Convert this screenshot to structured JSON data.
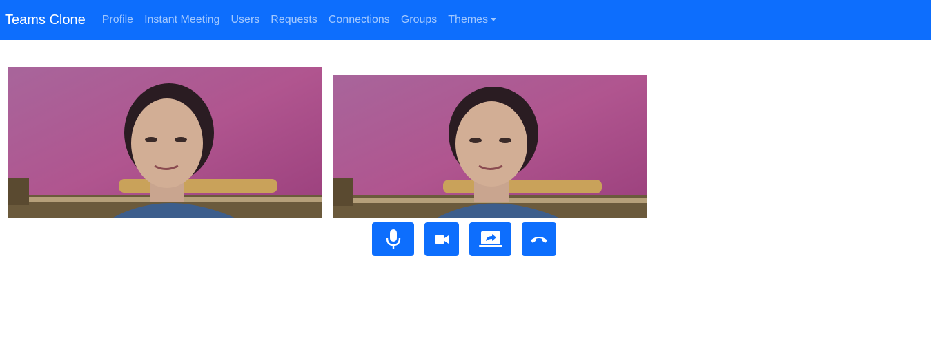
{
  "navbar": {
    "brand": "Teams Clone",
    "links": [
      {
        "label": "Profile"
      },
      {
        "label": "Instant Meeting"
      },
      {
        "label": "Users"
      },
      {
        "label": "Requests"
      },
      {
        "label": "Connections"
      },
      {
        "label": "Groups"
      }
    ],
    "themes_dropdown": {
      "label": "Themes"
    },
    "background_color": "#0d6efd"
  },
  "videos": {
    "local": {
      "label": "webcam-feed"
    },
    "remote": {
      "label": "webcam-feed"
    }
  },
  "controls": {
    "color": "#0d6efd",
    "buttons": [
      {
        "name": "mute-microphone",
        "icon": "microphone-icon"
      },
      {
        "name": "toggle-video",
        "icon": "video-camera-icon"
      },
      {
        "name": "share-screen",
        "icon": "screen-share-icon"
      },
      {
        "name": "end-call",
        "icon": "phone-hangup-icon"
      }
    ]
  }
}
